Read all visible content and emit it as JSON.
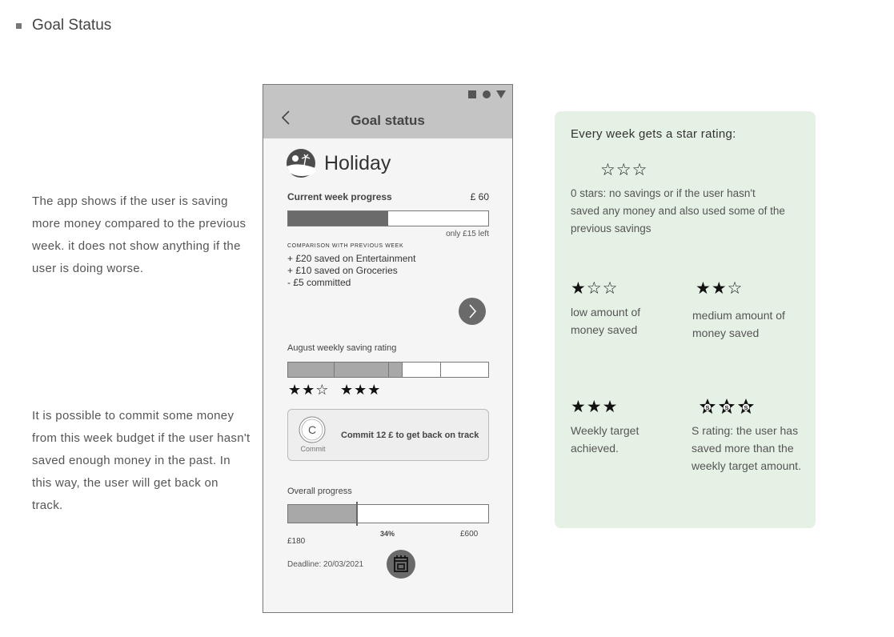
{
  "page": {
    "title": "Goal Status"
  },
  "notes": {
    "progress_note": "The app shows if the user is saving more money compared to the previous week. it does not show anything if the user is doing worse.",
    "commit_note": "It is possible to commit some money from this week budget if the user hasn't saved enough money in the past. In this way, the user will get back on track."
  },
  "phone": {
    "appbar_title": "Goal status",
    "goal": {
      "name": "Holiday",
      "icon": "holiday-beach-icon"
    },
    "current_week": {
      "label": "Current week progress",
      "amount": "£ 60",
      "progress_fraction": 0.5,
      "left_text": "only £15 left"
    },
    "comparison": {
      "heading": "COMPARISON WITH PREVIOUS WEEK",
      "lines": [
        "+ £20 saved on Entertainment",
        "+ £10 saved on Groceries",
        "- £5 committed"
      ]
    },
    "next_button_icon": "chevron-right-icon",
    "weekly_rating": {
      "label": "August weekly saving rating",
      "weeks_filled": 3,
      "weeks_total": 5,
      "stars_week1": "★★☆",
      "stars_week2": "★★★"
    },
    "commit": {
      "icon_letter": "C",
      "icon_label": "Commit",
      "text": "Commit 12 £ to get back on track"
    },
    "overall": {
      "label": "Overall progress",
      "percent_text": "34%",
      "progress_fraction": 0.34,
      "min": "£180",
      "max": "£600"
    },
    "deadline": "Deadline: 20/03/2021",
    "calendar_icon": "calendar-icon"
  },
  "panel": {
    "title": "Every week gets a star rating:",
    "ratings": [
      {
        "stars": "☆☆☆",
        "text": "0 stars: no savings or if the user hasn't saved any money and also used some of the previous savings"
      },
      {
        "stars": "★☆☆",
        "text": "low amount of money saved"
      },
      {
        "stars": "★★☆",
        "text": "medium amount of money saved"
      },
      {
        "stars": "★★★",
        "text": "Weekly target achieved."
      },
      {
        "stars": "SSS",
        "text": "S rating: the user has saved more than the weekly target amount."
      }
    ]
  },
  "colors": {
    "panel_bg": "#e6f1e5",
    "appbar_bg": "#c4c4c4",
    "progress_dark": "#6b6b6b",
    "progress_light": "#a8a8a8"
  }
}
